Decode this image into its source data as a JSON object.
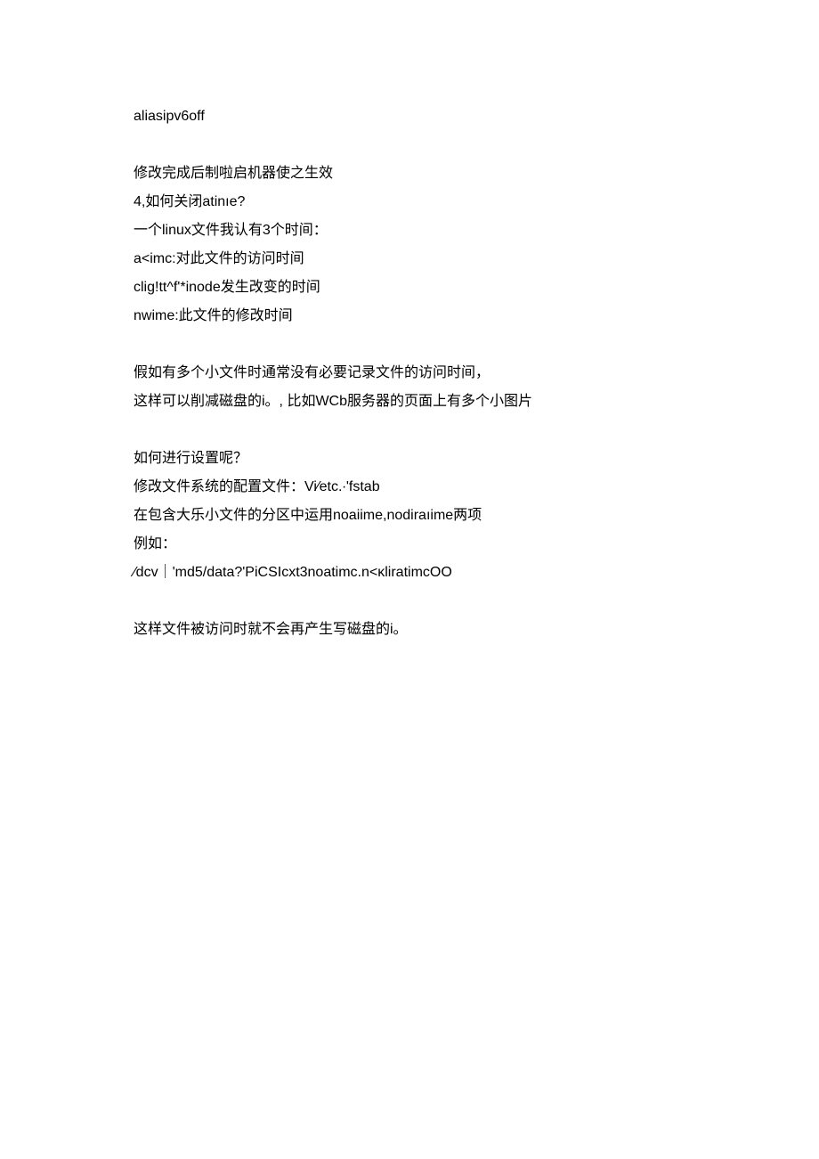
{
  "blocks": [
    {
      "lines": [
        "aliasipv6off"
      ]
    },
    {
      "lines": [
        "修改完成后制啦启机器使之生效",
        "4,如何关闭atinıe?",
        "一个linux文件我认有3个时间：",
        "a<imc:对此文件的访问时间",
        "clig!tt^f'*inode发生改变的时间",
        "nwime:此文件的修改时间"
      ]
    },
    {
      "lines": [
        "假如有多个小文件时通常没有必要记录文件的访问时间，",
        "这样可以削减磁盘的i。, 比如WCb服务器的页面上有多个小图片"
      ]
    },
    {
      "lines": [
        "如何进行设置呢？",
        "修改文件系统的配置文件：Vi∕etc.∙'fstab",
        "在包含大乐小文件的分区中运用noaiime,nodiraıime两项",
        "例如：",
        "∕dcv｜'md5/data?'PiCSIcxt3noatimc.n<κliratimcOO"
      ]
    },
    {
      "lines": [
        "这样文件被访问时就不会再产生写磁盘的i。"
      ]
    }
  ]
}
